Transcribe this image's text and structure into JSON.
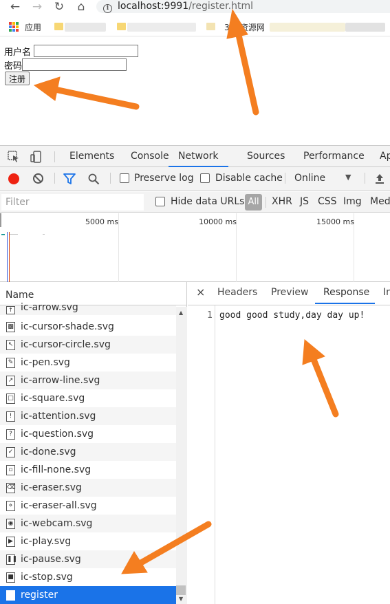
{
  "browser": {
    "url_host": "localhost:9991",
    "url_path": "/register.html",
    "bookmarks": {
      "apps_label": "应用",
      "item_label": "360资源网"
    }
  },
  "page": {
    "username_label": "用户名",
    "password_label": "密码",
    "register_button": "注册"
  },
  "devtools": {
    "tabs": [
      "Elements",
      "Console",
      "Network",
      "Sources",
      "Performance",
      "Ap"
    ],
    "active_tab": "Network",
    "toolbar": {
      "preserve_log": "Preserve log",
      "disable_cache": "Disable cache",
      "throttle": "Online"
    },
    "filter": {
      "placeholder": "Filter",
      "hide_data_urls": "Hide data URLs",
      "types": [
        "All",
        "XHR",
        "JS",
        "CSS",
        "Img",
        "Med"
      ]
    },
    "timeline": {
      "labels": [
        "5000 ms",
        "10000 ms",
        "15000 ms"
      ]
    },
    "requests": {
      "header": "Name",
      "items": [
        "ic-arrow.svg",
        "ic-cursor-shade.svg",
        "ic-cursor-circle.svg",
        "ic-pen.svg",
        "ic-arrow-line.svg",
        "ic-square.svg",
        "ic-attention.svg",
        "ic-question.svg",
        "ic-done.svg",
        "ic-fill-none.svg",
        "ic-eraser.svg",
        "ic-eraser-all.svg",
        "ic-webcam.svg",
        "ic-play.svg",
        "ic-pause.svg",
        "ic-stop.svg",
        "register"
      ],
      "selected": "register"
    },
    "detail": {
      "close": "×",
      "tabs": [
        "Headers",
        "Preview",
        "Response",
        "In"
      ],
      "active_tab": "Response",
      "line_number": "1",
      "response_text": "good good study,day day up!"
    }
  },
  "colors": {
    "accent": "#1a73e8",
    "record": "#ee2211",
    "annotation_arrow": "#f47e20"
  }
}
